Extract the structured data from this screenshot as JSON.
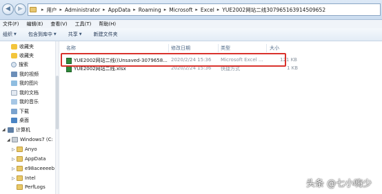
{
  "address_bar": {
    "crumbs": [
      "用户",
      "Administrator",
      "AppData",
      "Roaming",
      "Microsoft",
      "Excel",
      "YUE2002网站二线307965163914509652"
    ]
  },
  "menu": [
    "文件(F)",
    "编辑(E)",
    "查看(V)",
    "工具(T)",
    "帮助(H)"
  ],
  "toolbar": {
    "organize": "组织",
    "include_in_library": "包含到库中",
    "share": "共享",
    "new_folder": "新建文件夹"
  },
  "nav_pane": {
    "items": [
      {
        "label": "收藏夹",
        "icon": "star-icon"
      },
      {
        "label": "收藏夹",
        "icon": "star-icon"
      },
      {
        "label": "搜索",
        "icon": "search-icon"
      },
      {
        "label": "我的视频",
        "icon": "video-icon"
      },
      {
        "label": "我的图片",
        "icon": "picture-icon"
      },
      {
        "label": "我的文档",
        "icon": "document-icon"
      },
      {
        "label": "我的音乐",
        "icon": "music-icon"
      },
      {
        "label": "下载",
        "icon": "download-icon"
      },
      {
        "label": "桌面",
        "icon": "desktop-icon"
      },
      {
        "label": "计算机",
        "icon": "computer-icon"
      },
      {
        "label": "Windows7 (C:",
        "icon": "drive-icon"
      },
      {
        "label": "Anyo",
        "icon": "folder-icon"
      },
      {
        "label": "AppData",
        "icon": "folder-icon"
      },
      {
        "label": "e98aceeeeb",
        "icon": "folder-icon"
      },
      {
        "label": "Intel",
        "icon": "folder-icon"
      },
      {
        "label": "PerfLogs",
        "icon": "folder-icon"
      }
    ]
  },
  "columns": {
    "name": "名称",
    "date": "修改日期",
    "type": "类型",
    "size": "大小"
  },
  "files": [
    {
      "name": "YUE2002网站二线((Unsaved-3079658...",
      "date": "2020/2/24 15:36",
      "type": "Microsoft Excel ...",
      "size": "121 KB"
    },
    {
      "name": "YUE2002网站二线.xlsx",
      "date": "2020/2/24 15:36",
      "type": "快捷方式",
      "size": "1 KB"
    }
  ],
  "watermark": "头条 @七小嗨少",
  "colors": {
    "highlight": "#d9312b",
    "accent": "#4d6887"
  }
}
